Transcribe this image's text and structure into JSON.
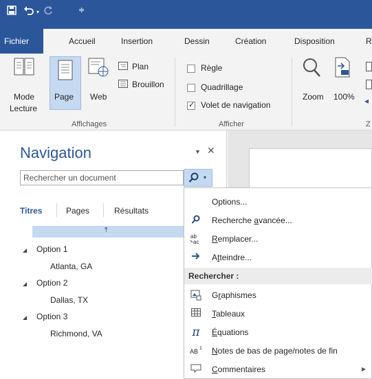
{
  "qat": {
    "save_icon": "save-icon",
    "undo_icon": "undo-icon",
    "redo_icon": "redo-icon",
    "customize_icon": "customize-icon"
  },
  "tabs": {
    "file": "Fichier",
    "home": "Accueil",
    "insert": "Insertion",
    "draw": "Dessin",
    "design": "Création",
    "layout": "Disposition",
    "overflow": "R"
  },
  "ribbon": {
    "views": {
      "read_mode": "Mode",
      "read_mode_2": "Lecture",
      "page": "Page",
      "web": "Web",
      "outline": "Plan",
      "draft": "Brouillon",
      "group": "Affichages"
    },
    "show": {
      "ruler": "Règle",
      "gridlines": "Quadrillage",
      "nav_pane": "Volet de navigation",
      "group": "Afficher",
      "ruler_checked": false,
      "gridlines_checked": false,
      "nav_pane_checked": true
    },
    "zoom": {
      "zoom": "Zoom",
      "hundred": "100%",
      "group_cut": "Z"
    }
  },
  "nav": {
    "title": "Navigation",
    "search_placeholder": "Rechercher un document",
    "tabs": [
      "Titres",
      "Pages",
      "Résultats"
    ],
    "headings": [
      {
        "label": "Option 1",
        "child": "Atlanta, GA"
      },
      {
        "label": "Option 2",
        "child": "Dallas, TX"
      },
      {
        "label": "Option 3",
        "child": "Richmond, VA"
      }
    ]
  },
  "menu": {
    "options": "Options...",
    "advanced_find_pre": "Recherche ",
    "advanced_find_u": "a",
    "advanced_find_post": "vancée...",
    "replace_u": "R",
    "replace_post": "emplacer...",
    "goto_pre": "A",
    "goto_u": "t",
    "goto_post": "teindre...",
    "find_header": "Rechercher :",
    "graphics_pre": "G",
    "graphics_u": "r",
    "graphics_post": "aphismes",
    "tables_u": "T",
    "tables_post": "ableaux",
    "equations_u": "É",
    "equations_post": "quations",
    "footnotes_u": "N",
    "footnotes_post": "otes de bas de page/notes de fin",
    "comments_u": "C",
    "comments_post": "ommentaires"
  },
  "colors": {
    "brand": "#2b579a",
    "selection": "#c5d9f1"
  }
}
